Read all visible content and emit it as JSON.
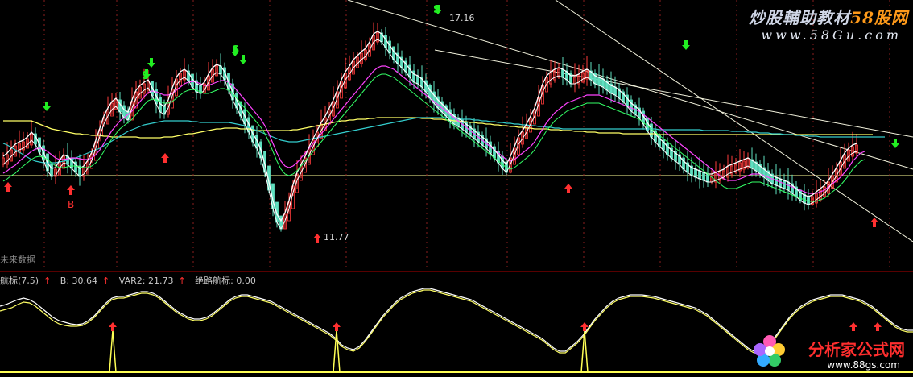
{
  "chart_data": {
    "type": "line",
    "subtype": "candlestick",
    "main_panel": {
      "high_label": "17.16",
      "low_label": "11.77",
      "future_label": "未来数据",
      "signal_b": "B",
      "signal_s": "S",
      "x": [
        0,
        5,
        10,
        15,
        20,
        25,
        30,
        35,
        40,
        45,
        50,
        55,
        60,
        65,
        70,
        75,
        80,
        85,
        90,
        95,
        100,
        105,
        110,
        115,
        120,
        125,
        130,
        135,
        140,
        145,
        150,
        155,
        160,
        165,
        170,
        175,
        180,
        185,
        190,
        195,
        200,
        205,
        210,
        215,
        220,
        225,
        230,
        235,
        240,
        245,
        250,
        255,
        260,
        265,
        270,
        275,
        280,
        285,
        290,
        295,
        300,
        305,
        310,
        315,
        320,
        325,
        330,
        335,
        340,
        345,
        350,
        355,
        360,
        365,
        370,
        375,
        380,
        385,
        390,
        395,
        400,
        405,
        410,
        415,
        420,
        425,
        430,
        435,
        440,
        445,
        450,
        455,
        460,
        465,
        470,
        475,
        480,
        485,
        490,
        495,
        500,
        505,
        510,
        515,
        520,
        525,
        530,
        535,
        540,
        545,
        550,
        555,
        560,
        565,
        570,
        575,
        580,
        585,
        590,
        595,
        600,
        605,
        610,
        615,
        620,
        625,
        630,
        635,
        640,
        645,
        650,
        655,
        660,
        665,
        670,
        675,
        680,
        685,
        690,
        695,
        700,
        705,
        710,
        715,
        720,
        725,
        730,
        735,
        740,
        745,
        750,
        755,
        760,
        765,
        770,
        775,
        780,
        785,
        790,
        795,
        800,
        805,
        810,
        815,
        820,
        825,
        830,
        835,
        840,
        845,
        850,
        855,
        860,
        865,
        870,
        875,
        880,
        885,
        890,
        895,
        900,
        905,
        910,
        915,
        920,
        925,
        930,
        935,
        940,
        945,
        950,
        955,
        960,
        965,
        970,
        975,
        980,
        985,
        990,
        995,
        1000,
        1005,
        1010,
        1015,
        1020,
        1025,
        1030,
        1035,
        1040,
        1045,
        1050,
        1055,
        1060,
        1065,
        1070,
        1075,
        1080,
        1085,
        1090,
        1095,
        1100,
        1105,
        1110,
        1115,
        1120
      ],
      "price_line": [
        200,
        196,
        190,
        185,
        182,
        180,
        176,
        170,
        175,
        185,
        195,
        208,
        215,
        214,
        205,
        198,
        200,
        205,
        210,
        215,
        212,
        205,
        195,
        180,
        165,
        150,
        140,
        132,
        128,
        135,
        142,
        145,
        130,
        118,
        112,
        108,
        105,
        115,
        125,
        135,
        138,
        130,
        115,
        102,
        95,
        92,
        96,
        104,
        110,
        112,
        108,
        98,
        90,
        86,
        88,
        95,
        108,
        120,
        130,
        140,
        150,
        160,
        172,
        180,
        192,
        210,
        232,
        255,
        272,
        280,
        270,
        255,
        235,
        220,
        210,
        200,
        188,
        178,
        168,
        158,
        150,
        140,
        130,
        118,
        105,
        95,
        88,
        80,
        75,
        70,
        66,
        58,
        48,
        45,
        48,
        55,
        62,
        70,
        75,
        80,
        85,
        92,
        98,
        100,
        104,
        110,
        118,
        124,
        130,
        135,
        140,
        146,
        150,
        153,
        156,
        160,
        164,
        168,
        172,
        176,
        180,
        186,
        192,
        198,
        205,
        210,
        200,
        188,
        175,
        168,
        160,
        150,
        140,
        125,
        110,
        100,
        95,
        92,
        90,
        92,
        95,
        100,
        100,
        98,
        94,
        92,
        95,
        100,
        102,
        104,
        108,
        112,
        114,
        118,
        122,
        128,
        134,
        138,
        142,
        150,
        158,
        166,
        172,
        178,
        182,
        188,
        192,
        196,
        200,
        206,
        210,
        214,
        216,
        218,
        220,
        222,
        222,
        220,
        218,
        216,
        212,
        210,
        208,
        206,
        204,
        202,
        205,
        208,
        212,
        216,
        220,
        224,
        226,
        228,
        230,
        232,
        236,
        240,
        245,
        248,
        250,
        248,
        244,
        240,
        236,
        230,
        222,
        214,
        205,
        196,
        190,
        186,
        184
      ],
      "ma_yellow": [
        150,
        150,
        150,
        150,
        150,
        150,
        150,
        150,
        152,
        154,
        156,
        158,
        160,
        161,
        162,
        163,
        164,
        165,
        166,
        166,
        167,
        167,
        168,
        168,
        168,
        169,
        169,
        170,
        170,
        170,
        170,
        170,
        170,
        170,
        171,
        171,
        171,
        171,
        171,
        171,
        170,
        170,
        170,
        169,
        168,
        167,
        166,
        166,
        165,
        164,
        163,
        162,
        161,
        160,
        160,
        159,
        159,
        159,
        159,
        160,
        160,
        160,
        161,
        162,
        162,
        162,
        162,
        162,
        162,
        162,
        162,
        162,
        161,
        161,
        160,
        159,
        158,
        157,
        156,
        155,
        154,
        153,
        152,
        151,
        150,
        150,
        149,
        149,
        148,
        148,
        148,
        147,
        147,
        146,
        146,
        146,
        146,
        146,
        146,
        146,
        146,
        146,
        146,
        146,
        147,
        147,
        147,
        148,
        148,
        148,
        149,
        149,
        150,
        150,
        151,
        151,
        152,
        152,
        153,
        153,
        154,
        154,
        155,
        155,
        156,
        156,
        157,
        157,
        158,
        158,
        159,
        159,
        160,
        160,
        160,
        160,
        161,
        161,
        161,
        162,
        162,
        162,
        163,
        163,
        163,
        164,
        164,
        164,
        165,
        165,
        165,
        165,
        165,
        165,
        166,
        166,
        166,
        166,
        166,
        166,
        166,
        166,
        166,
        167,
        167,
        167,
        167,
        167,
        167,
        167,
        167,
        167,
        167,
        167,
        167,
        167,
        167,
        167,
        167,
        167,
        167,
        167,
        167,
        167,
        167,
        167,
        167,
        167,
        167,
        167,
        167,
        167,
        167,
        167,
        167,
        167,
        167,
        167,
        167,
        167,
        167,
        167,
        167,
        167,
        167,
        167,
        167,
        167,
        167,
        167,
        167,
        167,
        167,
        167,
        167,
        167,
        167
      ],
      "ma_magenta": [
        215,
        212,
        208,
        205,
        200,
        196,
        192,
        188,
        185,
        184,
        185,
        188,
        192,
        196,
        198,
        198,
        197,
        196,
        196,
        197,
        198,
        198,
        196,
        192,
        186,
        178,
        170,
        162,
        156,
        150,
        146,
        142,
        138,
        132,
        126,
        120,
        115,
        113,
        114,
        116,
        118,
        118,
        116,
        112,
        108,
        104,
        102,
        101,
        102,
        104,
        106,
        106,
        104,
        102,
        100,
        100,
        102,
        106,
        112,
        118,
        124,
        130,
        136,
        142,
        148,
        156,
        166,
        178,
        190,
        200,
        206,
        208,
        206,
        202,
        196,
        190,
        184,
        178,
        172,
        166,
        160,
        154,
        148,
        142,
        136,
        130,
        124,
        118,
        112,
        106,
        100,
        94,
        88,
        84,
        82,
        82,
        84,
        86,
        90,
        94,
        98,
        102,
        106,
        110,
        114,
        118,
        122,
        126,
        130,
        134,
        138,
        142,
        146,
        150,
        154,
        158,
        162,
        166,
        170,
        174,
        178,
        182,
        186,
        190,
        194,
        198,
        200,
        198,
        194,
        190,
        186,
        182,
        176,
        168,
        160,
        152,
        146,
        140,
        136,
        132,
        128,
        126,
        124,
        122,
        120,
        118,
        118,
        118,
        118,
        120,
        122,
        124,
        126,
        128,
        130,
        132,
        134,
        136,
        138,
        142,
        146,
        150,
        154,
        158,
        162,
        166,
        170,
        174,
        178,
        182,
        186,
        190,
        194,
        198,
        202,
        206,
        210,
        214,
        218,
        222,
        224,
        224,
        224,
        222,
        220,
        218,
        216,
        216,
        216,
        218,
        220,
        222,
        224,
        226,
        228,
        230,
        232,
        234,
        236,
        238,
        240,
        240,
        240,
        238,
        236,
        232,
        228,
        224,
        220,
        214,
        208,
        200,
        195,
        190,
        188
      ],
      "ma_cyan": [
        178,
        180,
        183,
        186,
        189,
        192,
        195,
        198,
        200,
        201,
        202,
        202,
        202,
        202,
        201,
        200,
        199,
        198,
        196,
        194,
        192,
        190,
        188,
        186,
        184,
        181,
        178,
        175,
        172,
        169,
        166,
        163,
        161,
        159,
        157,
        155,
        154,
        153,
        152,
        151,
        150,
        150,
        150,
        150,
        150,
        150,
        150,
        151,
        151,
        152,
        152,
        152,
        152,
        152,
        152,
        152,
        152,
        153,
        154,
        155,
        156,
        158,
        160,
        162,
        164,
        166,
        168,
        170,
        172,
        174,
        175,
        176,
        176,
        176,
        175,
        174,
        173,
        172,
        171,
        170,
        169,
        168,
        167,
        166,
        165,
        164,
        163,
        162,
        161,
        160,
        159,
        158,
        157,
        156,
        155,
        154,
        153,
        152,
        151,
        150,
        149,
        148,
        147,
        146,
        146,
        146,
        146,
        146,
        146,
        146,
        146,
        147,
        147,
        147,
        148,
        148,
        148,
        149,
        149,
        150,
        150,
        151,
        151,
        152,
        152,
        153,
        153,
        154,
        154,
        155,
        155,
        156,
        156,
        157,
        157,
        158,
        158,
        159,
        159,
        160,
        160,
        160,
        160,
        160,
        160,
        160,
        160,
        160,
        160,
        160,
        160,
        160,
        160,
        160,
        160,
        160,
        160,
        160,
        160,
        160,
        160,
        160,
        160,
        161,
        161,
        161,
        161,
        161,
        161,
        161,
        161,
        161,
        161,
        161,
        162,
        162,
        162,
        162,
        162,
        162,
        162,
        163,
        163,
        163,
        163,
        164,
        164,
        164,
        165,
        165,
        165,
        166,
        166,
        166,
        167,
        167,
        167,
        168,
        168,
        168,
        169,
        169,
        169,
        170,
        170,
        170,
        170,
        170,
        170,
        170,
        170,
        170,
        170,
        170,
        170,
        170,
        170,
        170,
        170,
        170
      ]
    },
    "indicator": {
      "name": "航标(7,5)",
      "b_label": "B: 30.64",
      "var2_label": "VAR2: 21.73",
      "jlhb_label": "绝路航标: 0.00",
      "signal_positions": [
        140,
        418,
        726
      ],
      "line_white": [
        380,
        378,
        375,
        372,
        370,
        372,
        376,
        382,
        388,
        394,
        398,
        400,
        402,
        403,
        402,
        398,
        392,
        384,
        376,
        370,
        368,
        368,
        366,
        364,
        362,
        362,
        364,
        368,
        374,
        380,
        386,
        390,
        394,
        396,
        396,
        394,
        390,
        384,
        378,
        372,
        368,
        366,
        366,
        368,
        370,
        372,
        374,
        378,
        382,
        386,
        390,
        394,
        398,
        402,
        406,
        410,
        414,
        420,
        428,
        432,
        434,
        430,
        422,
        412,
        402,
        392,
        384,
        376,
        370,
        366,
        362,
        360,
        358,
        358,
        360,
        362,
        364,
        366,
        368,
        370,
        372,
        376,
        380,
        384,
        388,
        392,
        396,
        400,
        404,
        408,
        412,
        416,
        420,
        426,
        432,
        436,
        436,
        430,
        424,
        416,
        406,
        396,
        388,
        380,
        374,
        370,
        368,
        366,
        366,
        366,
        367,
        368,
        370,
        372,
        374,
        376,
        378,
        380,
        382,
        386,
        390,
        396,
        402,
        408,
        414,
        420,
        426,
        432,
        436,
        436,
        432,
        424,
        414,
        404,
        394,
        386,
        380,
        376,
        372,
        370,
        368,
        366,
        366,
        366,
        368,
        370,
        372,
        376,
        380,
        386,
        392,
        398,
        404,
        408,
        410,
        410
      ],
      "line_yellow": [
        386,
        384,
        382,
        378,
        375,
        376,
        380,
        386,
        392,
        398,
        402,
        404,
        405,
        405,
        404,
        400,
        394,
        386,
        378,
        372,
        370,
        370,
        368,
        366,
        364,
        364,
        366,
        370,
        376,
        382,
        388,
        392,
        396,
        398,
        398,
        396,
        392,
        386,
        380,
        374,
        370,
        368,
        368,
        370,
        372,
        374,
        376,
        380,
        384,
        388,
        392,
        396,
        400,
        404,
        408,
        412,
        416,
        422,
        430,
        434,
        436,
        432,
        424,
        414,
        404,
        394,
        386,
        378,
        372,
        368,
        364,
        362,
        360,
        360,
        362,
        364,
        366,
        368,
        370,
        372,
        374,
        378,
        382,
        386,
        390,
        394,
        398,
        402,
        406,
        410,
        414,
        418,
        422,
        428,
        434,
        438,
        438,
        432,
        426,
        418,
        408,
        398,
        390,
        382,
        376,
        372,
        370,
        368,
        368,
        368,
        369,
        370,
        372,
        374,
        376,
        378,
        380,
        382,
        384,
        388,
        392,
        398,
        404,
        410,
        416,
        422,
        428,
        434,
        438,
        438,
        434,
        426,
        416,
        406,
        396,
        388,
        382,
        378,
        374,
        372,
        370,
        368,
        368,
        368,
        370,
        372,
        374,
        378,
        382,
        388,
        394,
        400,
        406,
        410,
        412,
        412
      ]
    }
  },
  "watermarks": {
    "site_title": "炒股輔助教材",
    "site_brand": "58股网",
    "site_url": "www.58Gu.com",
    "bottom_brand": "分析家公式网",
    "bottom_url": "www.88gs.com"
  },
  "colors": {
    "up": "#ff3b3b",
    "down": "#5fe0c0",
    "ma_white": "#ffffff",
    "ma_yellow": "#ffff66",
    "ma_magenta": "#ff44ff",
    "ma_cyan": "#33cccc",
    "ma_green": "#33ff66",
    "signal_b": "#ff3030",
    "signal_s": "#22ee22",
    "divider": "#b00000"
  }
}
